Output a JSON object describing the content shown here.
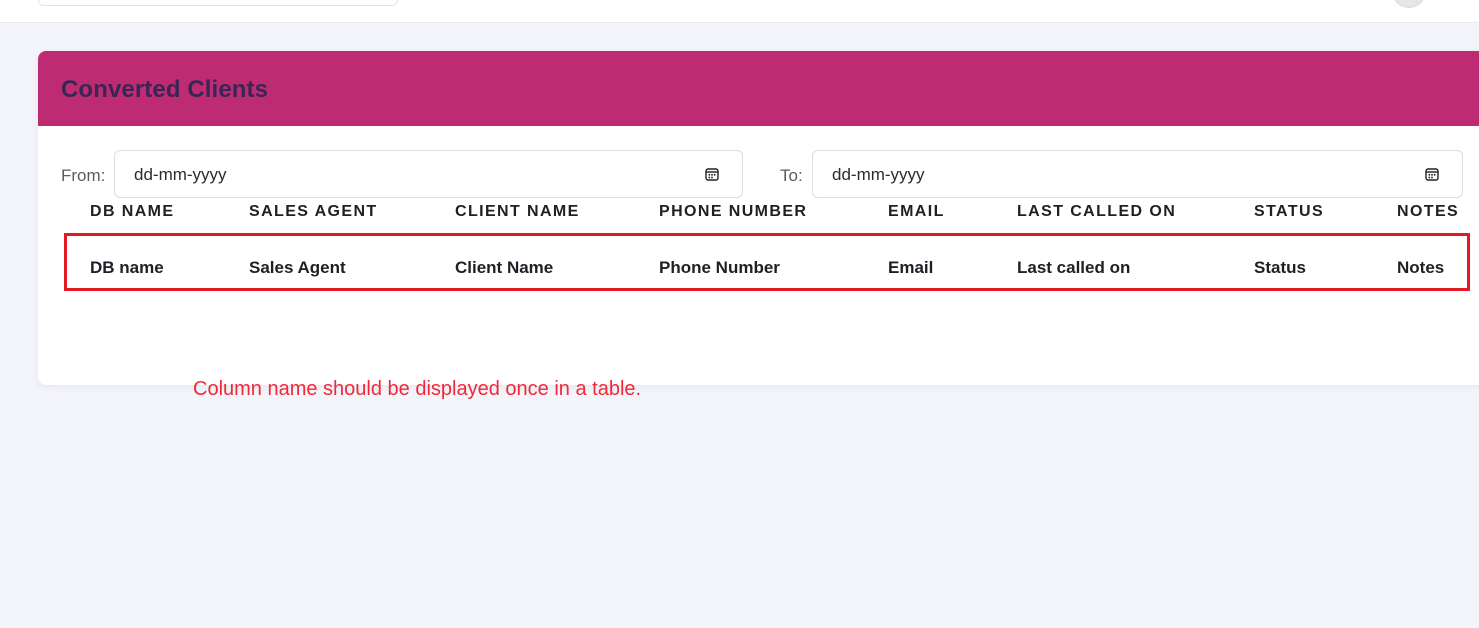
{
  "card": {
    "title": "Converted Clients"
  },
  "filters": {
    "from_label": "From:",
    "from_value": "dd-mm-yyyy",
    "to_label": "To:",
    "to_value": "dd-mm-yyyy"
  },
  "table": {
    "headers": [
      "DB NAME",
      "SALES AGENT",
      "CLIENT NAME",
      "PHONE NUMBER",
      "EMAIL",
      "LAST CALLED ON",
      "STATUS",
      "NOTES"
    ],
    "rows": [
      [
        "DB name",
        "Sales Agent",
        "Client Name",
        "Phone Number",
        "Email",
        "Last called on",
        "Status",
        "Notes"
      ]
    ]
  },
  "annotation": {
    "text": "Column name should be displayed once in a table."
  },
  "colors": {
    "header_bg": "#bd2c72",
    "title_text": "#3b2456",
    "highlight_border": "#e01b24",
    "annotation_text": "#ee2a3a",
    "page_bg": "#f4f5fa"
  }
}
